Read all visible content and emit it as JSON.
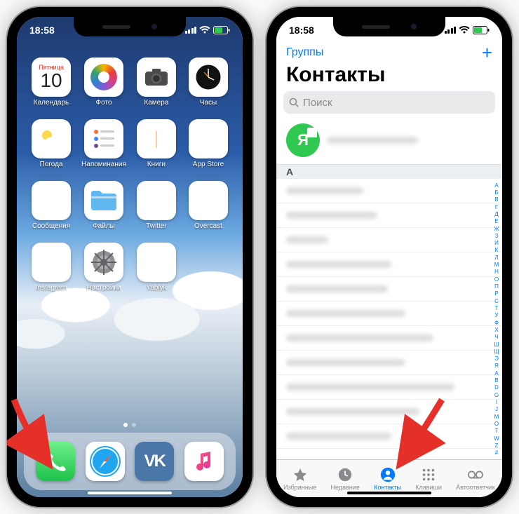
{
  "status": {
    "time": "18:58"
  },
  "home": {
    "calendar": {
      "day": "Пятница",
      "date": "10"
    },
    "apps": [
      {
        "label": "Календарь",
        "icon": "calendar"
      },
      {
        "label": "Фото",
        "icon": "photos"
      },
      {
        "label": "Камера",
        "icon": "camera"
      },
      {
        "label": "Часы",
        "icon": "clock"
      },
      {
        "label": "Погода",
        "icon": "weather"
      },
      {
        "label": "Напоминания",
        "icon": "reminders"
      },
      {
        "label": "Книги",
        "icon": "books"
      },
      {
        "label": "App Store",
        "icon": "appstore"
      },
      {
        "label": "Сообщения",
        "icon": "messages"
      },
      {
        "label": "Файлы",
        "icon": "files"
      },
      {
        "label": "Twitter",
        "icon": "twitter"
      },
      {
        "label": "Overcast",
        "icon": "overcast"
      },
      {
        "label": "Instagram",
        "icon": "instagram"
      },
      {
        "label": "Настройки",
        "icon": "settings"
      },
      {
        "label": "Yablyk",
        "icon": "yablyk"
      }
    ],
    "dock": [
      {
        "icon": "phone"
      },
      {
        "icon": "safari"
      },
      {
        "icon": "vk"
      },
      {
        "icon": "music"
      }
    ]
  },
  "contacts": {
    "nav_left": "Группы",
    "nav_right": "+",
    "title": "Контакты",
    "search_placeholder": "Поиск",
    "me_avatar_letter": "Я",
    "section_header": "А",
    "index_rail": [
      "А",
      "Б",
      "В",
      "Г",
      "Д",
      "Е",
      "Ж",
      "З",
      "И",
      "К",
      "Л",
      "М",
      "Н",
      "О",
      "П",
      "Р",
      "С",
      "Т",
      "У",
      "Ф",
      "Х",
      "Ч",
      "Ш",
      "Щ",
      "Э",
      "Я",
      "A",
      "B",
      "D",
      "G",
      "I",
      "J",
      "M",
      "O",
      "T",
      "W",
      "Z",
      "#"
    ],
    "tabs": [
      {
        "label": "Избранные",
        "icon": "star"
      },
      {
        "label": "Недавние",
        "icon": "clock"
      },
      {
        "label": "Контакты",
        "icon": "person",
        "active": true
      },
      {
        "label": "Клавиши",
        "icon": "keypad"
      },
      {
        "label": "Автоответчик",
        "icon": "voicemail"
      }
    ]
  }
}
